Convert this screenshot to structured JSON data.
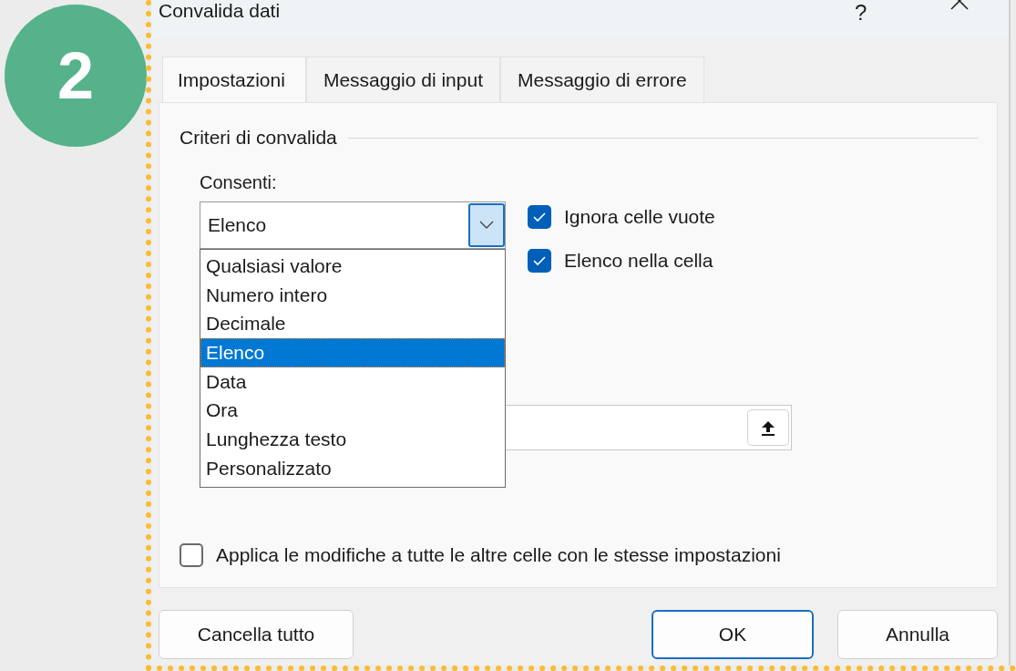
{
  "step_badge": "2",
  "window": {
    "title": "Convalida dati",
    "help": "?"
  },
  "tabs": [
    {
      "label": "Impostazioni",
      "selected": true
    },
    {
      "label": "Messaggio di input",
      "selected": false
    },
    {
      "label": "Messaggio di errore",
      "selected": false
    }
  ],
  "group": {
    "title": "Criteri di convalida"
  },
  "allow": {
    "label": "Consenti:",
    "value": "Elenco",
    "expanded": true,
    "options": [
      {
        "label": "Qualsiasi valore",
        "selected": false
      },
      {
        "label": "Numero intero",
        "selected": false
      },
      {
        "label": "Decimale",
        "selected": false
      },
      {
        "label": "Elenco",
        "selected": true
      },
      {
        "label": "Data",
        "selected": false
      },
      {
        "label": "Ora",
        "selected": false
      },
      {
        "label": "Lunghezza testo",
        "selected": false
      },
      {
        "label": "Personalizzato",
        "selected": false
      }
    ]
  },
  "options": [
    {
      "label": "Ignora celle vuote",
      "checked": true
    },
    {
      "label": "Elenco nella cella",
      "checked": true
    }
  ],
  "apply_all": {
    "label": "Applica le modifiche a tutte le altre celle con le stesse impostazioni",
    "checked": false
  },
  "buttons": [
    {
      "label": "Cancella tutto",
      "default": false
    },
    {
      "label": "OK",
      "default": true
    },
    {
      "label": "Annulla",
      "default": false
    }
  ]
}
